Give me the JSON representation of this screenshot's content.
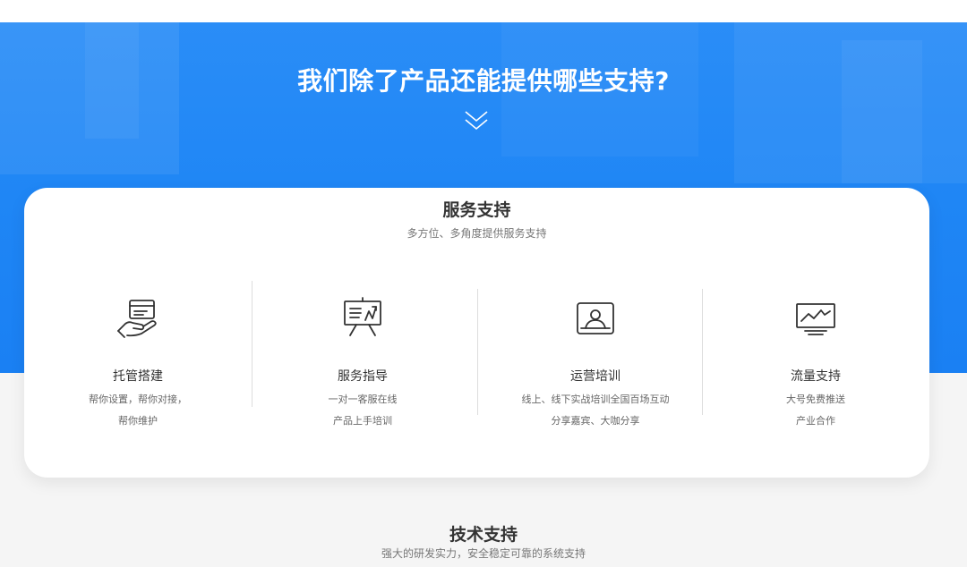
{
  "hero": {
    "title": "我们除了产品还能提供哪些支持?",
    "chevron_icon": "double-chevron-down-icon"
  },
  "service_support": {
    "title": "服务支持",
    "subtitle": "多方位、多角度提供服务支持",
    "items": [
      {
        "icon": "hand-card-icon",
        "name": "托管搭建",
        "line1": "帮你设置，帮你对接，",
        "line2": "帮你维护"
      },
      {
        "icon": "presentation-board-icon",
        "name": "服务指导",
        "line1": "一对一客服在线",
        "line2": "产品上手培训"
      },
      {
        "icon": "profile-card-icon",
        "name": "运营培训",
        "line1": "线上、线下实战培训全国百场互动",
        "line2": "分享嘉宾、大咖分享"
      },
      {
        "icon": "monitor-chart-icon",
        "name": "流量支持",
        "line1": "大号免费推送",
        "line2": "产业合作"
      }
    ]
  },
  "tech_support": {
    "title": "技术支持",
    "subtitle": "强大的研发实力，安全稳定可靠的系统支持"
  },
  "colors": {
    "hero_blue": "#1f86f5",
    "card_bg": "#ffffff",
    "page_bg": "#f5f5f5",
    "text_dark": "#333333"
  }
}
